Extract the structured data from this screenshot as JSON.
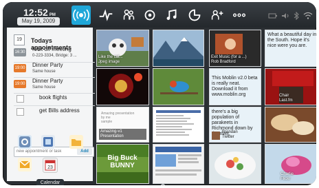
{
  "topbar": {
    "time": "12:52",
    "ampm": "PM",
    "date": "May 19, 2009",
    "nav_icons": [
      "broadcast-icon",
      "activity-icon",
      "people-icon",
      "media-icon",
      "music-icon",
      "pictures-icon",
      "add-people-icon",
      "apps-icon"
    ],
    "status_icons": [
      "battery-icon",
      "volume-icon",
      "bluetooth-icon",
      "wifi-icon"
    ],
    "accent": "#1fa7d9"
  },
  "appointments": {
    "title": "Todays appointments",
    "items": [
      {
        "time": "16:30",
        "title": "Kick off meeting",
        "sub": "0-223-3334, Bridge: 3 ...",
        "color": "#8d949a"
      },
      {
        "time": "19:00",
        "title": "Dinner Party",
        "sub": "Same house",
        "color": "#e6792b"
      },
      {
        "time": "19:00",
        "title": "Dinner Party",
        "sub": "Same house",
        "color": "#e6792b"
      }
    ],
    "todos": [
      "book flights",
      "get Bills address"
    ],
    "new_placeholder": "new appointment or task",
    "add_label": "Add"
  },
  "apps": [
    {
      "icon": "settings-icon",
      "label": ""
    },
    {
      "icon": "network-icon",
      "label": ""
    },
    {
      "icon": "folder-icon",
      "label": ""
    },
    {
      "icon": "mail-icon",
      "label": ""
    },
    {
      "icon": "calendar-icon",
      "label": "Calendar"
    }
  ],
  "tooltip": "Calendar",
  "tiles": [
    {
      "type": "image",
      "caption1": "Like the cat...",
      "caption2": "Jpeg image"
    },
    {
      "type": "image",
      "caption1": "",
      "caption2": ""
    },
    {
      "type": "image",
      "caption1": "Exit Music (for a ...)",
      "caption2": "Rob Bradford"
    },
    {
      "type": "text",
      "text": "What a beautiful day in the South. Hope it's nice were you are."
    },
    {
      "type": "image",
      "caption1": "",
      "caption2": ""
    },
    {
      "type": "image",
      "caption1": "",
      "caption2": ""
    },
    {
      "type": "text",
      "text": "This Moblin v2.0 beta is really neat. Download it from www.moblin.org"
    },
    {
      "type": "photo-label",
      "caption1": "Chair",
      "caption2": "Last.fm"
    },
    {
      "type": "doc",
      "title": "Amazing presentation",
      "sub1": "by me",
      "sub2": "sample",
      "caption1": "Amazing-v1",
      "caption2": "Presentation"
    },
    {
      "type": "web",
      "caption1": "",
      "caption2": ""
    },
    {
      "type": "tweet",
      "text": "there's a big population of parakeets in Richmond down by the river.",
      "caption1": "Brendan",
      "caption2": "Twitter"
    },
    {
      "type": "image",
      "caption1": "",
      "caption2": ""
    },
    {
      "type": "image",
      "caption1": "",
      "caption2": ""
    },
    {
      "type": "web",
      "caption1": "",
      "caption2": ""
    },
    {
      "type": "image",
      "caption1": "",
      "caption2": ""
    },
    {
      "type": "image",
      "caption1": "Charlie",
      "caption2": "Flickr"
    }
  ],
  "colors": {
    "panel": "#f4f5f6",
    "chrome": "#2b2f33"
  }
}
